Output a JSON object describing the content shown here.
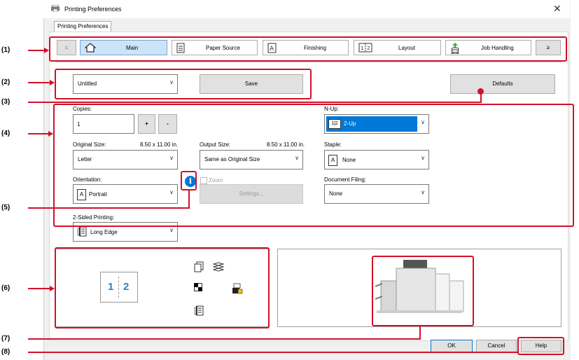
{
  "window": {
    "title": "Printing Preferences",
    "close": "✕",
    "tab": "Printing Preferences"
  },
  "nav": {
    "prev": "≤",
    "next": "≥",
    "items": [
      {
        "label": "Main",
        "icon": "home-icon"
      },
      {
        "label": "Paper Source",
        "icon": "paper-tray-icon"
      },
      {
        "label": "Finishing",
        "icon": "finishing-icon"
      },
      {
        "label": "Layout",
        "icon": "layout-icon"
      },
      {
        "label": "Job Handling",
        "icon": "job-handling-icon"
      }
    ]
  },
  "favorites": {
    "value": "Untitled",
    "save": "Save",
    "defaults": "Defaults"
  },
  "copies": {
    "label": "Copies:",
    "value": "1",
    "plus": "+",
    "minus": "-"
  },
  "original_size": {
    "label": "Original Size:",
    "dims": "8.50 x 11.00 in.",
    "value": "Letter"
  },
  "output_size": {
    "label": "Output Size:",
    "dims": "8.50 x 11.00 in.",
    "value": "Same as Original Size"
  },
  "orientation": {
    "label": "Orientation:",
    "value": "Portrait",
    "icon_glyph": "A"
  },
  "info": {
    "glyph": "i"
  },
  "zoom": {
    "label": "Zoom",
    "settings": "Settings..."
  },
  "two_sided": {
    "label": "2-Sided Printing:",
    "value": "Long Edge"
  },
  "nup": {
    "label": "N-Up:",
    "value": "2-Up",
    "icon_text": "1|2"
  },
  "staple": {
    "label": "Staple:",
    "value": "None",
    "icon_glyph": "A"
  },
  "filing": {
    "label": "Document Filing:",
    "value": "None"
  },
  "preview": {
    "page1": "1",
    "page2": "2"
  },
  "footer": {
    "ok": "OK",
    "cancel": "Cancel",
    "help": "Help"
  },
  "callouts": [
    "(1)",
    "(2)",
    "(3)",
    "(4)",
    "(5)",
    "(6)",
    "(7)",
    "(8)"
  ],
  "colors": {
    "accent": "#0078d7",
    "callout_red": "#d1112a",
    "selected_tab": "#cce4f7"
  }
}
